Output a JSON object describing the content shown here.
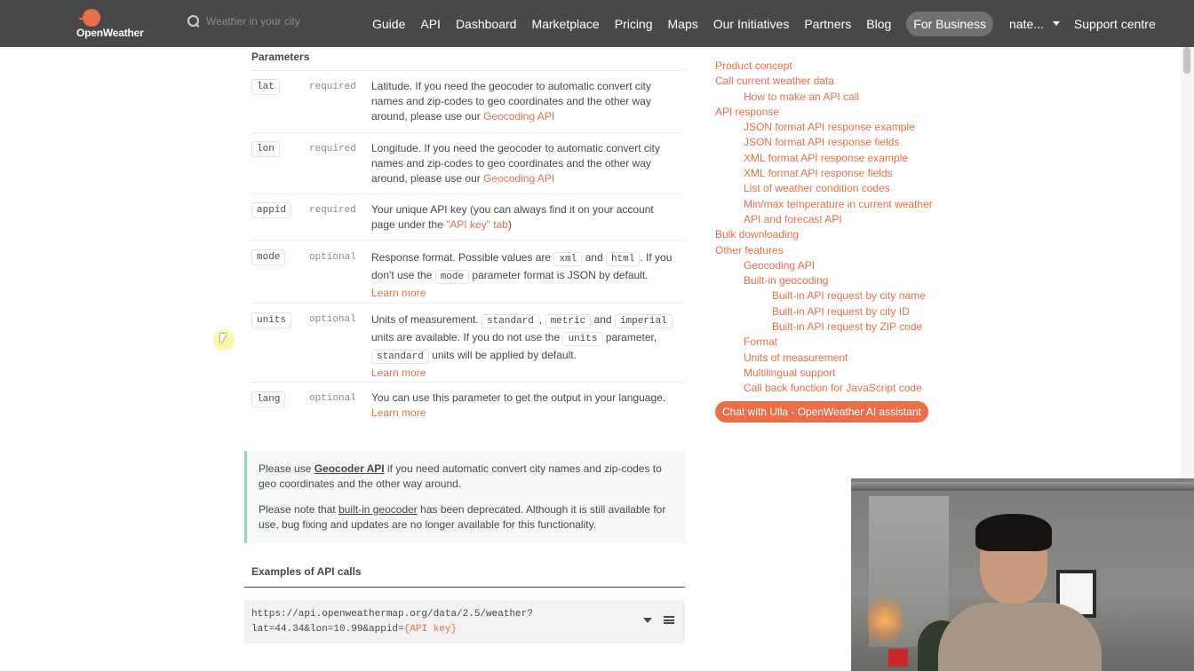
{
  "nav": {
    "logo_text": "OpenWeather",
    "search_placeholder": "Weather in your city",
    "links": [
      "Guide",
      "API",
      "Dashboard",
      "Marketplace",
      "Pricing",
      "Maps",
      "Our Initiatives",
      "Partners",
      "Blog"
    ],
    "business": "For Business",
    "user": "nate...",
    "support": "Support centre"
  },
  "params": {
    "heading": "Parameters",
    "rows": [
      {
        "name": "lat",
        "req": "required",
        "desc": "Latitude. If you need the geocoder to automatic convert city names and zip-codes to geo coordinates and the other way around, please use our ",
        "link": "Geocoding API"
      },
      {
        "name": "lon",
        "req": "required",
        "desc": "Longitude. If you need the geocoder to automatic convert city names and zip-codes to geo coordinates and the other way around, please use our ",
        "link": "Geocoding API"
      },
      {
        "name": "appid",
        "req": "required",
        "desc": "Your unique API key (you can always find it on your account page under the ",
        "link": "\"API key\" tab",
        "after": ")"
      },
      {
        "name": "mode",
        "req": "optional",
        "desc_a": "Response format. Possible values are ",
        "code1": "xml",
        "and": "and",
        "code2": "html",
        "desc_b": ". If you don't use the ",
        "code3": "mode",
        "desc_c": " parameter format is JSON by default.",
        "learn": "Learn more"
      },
      {
        "name": "units",
        "req": "optional",
        "desc_a": "Units of measurement. ",
        "code1": "standard",
        "comma": ",",
        "code2": "metric",
        "and": "and",
        "code3": "imperial",
        "desc_b": " units are available. If you do not use the ",
        "code4": "units",
        "desc_c": " parameter, ",
        "code5": "standard",
        "desc_d": " units will be applied by default.",
        "learn": "Learn more"
      },
      {
        "name": "lang",
        "req": "optional",
        "desc": "You can use this parameter to get the output in your language.",
        "learn": "Learn more"
      }
    ]
  },
  "note": {
    "p1_a": "Please use ",
    "p1_link": "Geocoder API",
    "p1_b": " if you need automatic convert city names and zip-codes to geo coordinates and the other way around.",
    "p2_a": "Please note that ",
    "p2_link": "built-in geocoder",
    "p2_b": " has been deprecated. Although it is still available for use, bug fixing and updates are no longer available for this functionality."
  },
  "examples": {
    "heading": "Examples of API calls",
    "line1": "https://api.openweathermap.org/data/2.5/weather?",
    "line2_a": "lat=44.34&lon=10.99&appid=",
    "line2_key": "{API key}"
  },
  "toc": {
    "items": [
      {
        "label": "Product concept",
        "level": 1
      },
      {
        "label": "Call current weather data",
        "level": 1
      },
      {
        "label": "How to make an API call",
        "level": 2
      },
      {
        "label": "API response",
        "level": 1
      },
      {
        "label": "JSON format API response example",
        "level": 2
      },
      {
        "label": "JSON format API response fields",
        "level": 2
      },
      {
        "label": "XML format API response example",
        "level": 2
      },
      {
        "label": "XML format API response fields",
        "level": 2
      },
      {
        "label": "List of weather condition codes",
        "level": 2
      },
      {
        "label": "Min/max temperature in current weather",
        "level": 2
      },
      {
        "label": "API and forecast API",
        "level": 2
      },
      {
        "label": "Bulk downloading",
        "level": 1
      },
      {
        "label": "Other features",
        "level": 1
      },
      {
        "label": "Geocoding API",
        "level": 2
      },
      {
        "label": "Built-in geocoding",
        "level": 2
      },
      {
        "label": "Built-in API request by city name",
        "level": 3
      },
      {
        "label": "Built-in API request by city ID",
        "level": 3
      },
      {
        "label": "Built-in API request by ZIP code",
        "level": 3
      },
      {
        "label": "Format",
        "level": 2
      },
      {
        "label": "Units of measurement",
        "level": 2
      },
      {
        "label": "Multilingual support",
        "level": 2
      },
      {
        "label": "Call back function for JavaScript code",
        "level": 2
      }
    ],
    "chat": "Chat with Ulla - OpenWeather AI assistant"
  },
  "colors": {
    "accent": "#eb6e4b",
    "nav_bg": "#48484a",
    "note_bg": "#f3f9f6",
    "note_border": "#9ad7b9"
  }
}
